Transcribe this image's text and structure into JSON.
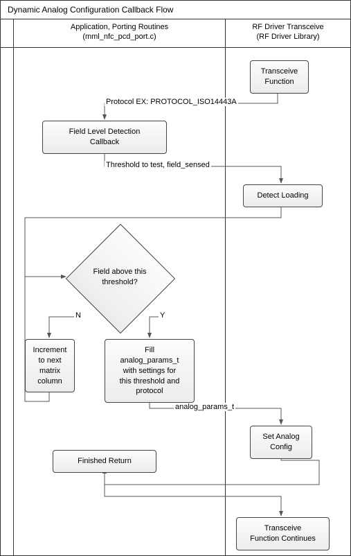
{
  "title": "Dynamic Analog Configuration Callback Flow",
  "lanes": {
    "app": {
      "line1": "Application, Porting Routines",
      "line2": "(mml_nfc_pcd_port.c)"
    },
    "rf": {
      "line1": "RF Driver Transceive",
      "line2": "(RF Driver Library)"
    }
  },
  "nodes": {
    "transceive_func": "Transceive\nFunction",
    "field_level_cb": "Field Level Detection\nCallback",
    "detect_loading": "Detect Loading",
    "decision": "Field above this\nthreshold?",
    "increment": "Increment\nto next\nmatrix\ncolumn",
    "fill_params": "Fill\nanalog_params_t\nwith settings for\nthis threshold and\nprotocol",
    "set_analog": "Set Analog\nConfig",
    "finished": "Finished Return",
    "continues": "Transceive\nFunction Continues"
  },
  "edges": {
    "protocol": "Protocol EX: PROTOCOL_ISO14443A",
    "threshold": "Threshold to test, field_sensed",
    "no": "N",
    "yes": "Y",
    "analog_params": "analog_params_t"
  }
}
